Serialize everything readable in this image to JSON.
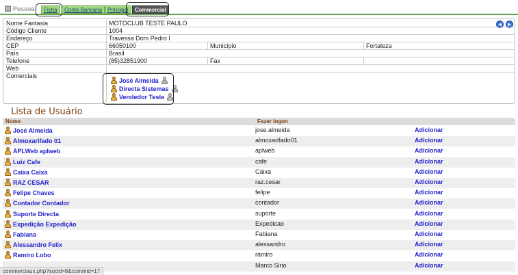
{
  "header": {
    "app_title": "Pessoa",
    "tabs": [
      {
        "label": "Ficha"
      },
      {
        "label": "Conta Bancaria"
      },
      {
        "label": "Principal"
      },
      {
        "label": "Commercial"
      }
    ]
  },
  "details": {
    "rows": [
      {
        "label": "Nome Fantasia",
        "value": "MOTOCLUB TESTE PAULO"
      },
      {
        "label": "Código Cliente",
        "value": "1004"
      },
      {
        "label": "Endereço",
        "value": "Travessa Dom Pedro I"
      },
      {
        "label": "CEP",
        "value": "66050100",
        "label2": "Município",
        "value2": "Fortaleza"
      },
      {
        "label": "País",
        "value": "Brasil"
      },
      {
        "label": "Telefone",
        "value": "(85)32851900",
        "label2": "Fax",
        "value2": ""
      },
      {
        "label": "Web",
        "value": ""
      }
    ],
    "comerciais_label": "Comerciais",
    "comerciais": [
      {
        "name": "José Almeida"
      },
      {
        "name": "Directa Sistemas"
      },
      {
        "name": "Vendedor Teste"
      }
    ]
  },
  "list": {
    "title": "Lista de Usuário",
    "col_name": "Nome",
    "col_login": "Fazer logon",
    "add_label": "Adicionar",
    "users": [
      {
        "name": "José Almeida",
        "login": "jose.almeida"
      },
      {
        "name": "Almoxarifado 01",
        "login": "almoxarifado01"
      },
      {
        "name": "APLWeb aplweb",
        "login": "aplweb"
      },
      {
        "name": "Luiz Cafe",
        "login": "cafe"
      },
      {
        "name": "Caixa Caixa",
        "login": "Caixa"
      },
      {
        "name": "RAZ CESAR",
        "login": "raz.cesar"
      },
      {
        "name": "Felipe Chaves",
        "login": "felipe"
      },
      {
        "name": "Contador Contador",
        "login": "contador"
      },
      {
        "name": "Suporte Directa",
        "login": "suporte"
      },
      {
        "name": "Expedição Expedição",
        "login": "Expedicao"
      },
      {
        "name": "Fabiana",
        "login": "Fabiana"
      },
      {
        "name": "Alessandro Felix",
        "login": "alessandro"
      },
      {
        "name": "Ramiro Lobo",
        "login": "ramiro"
      },
      {
        "name": "",
        "login": "Marco Sirio"
      }
    ]
  },
  "status_url": "commerciaux.php?socid=8&commid=17",
  "colors": {
    "tab": "#9edb7d",
    "tab_active": "#555555",
    "link": "#2222cc",
    "title": "#7a3a08"
  }
}
